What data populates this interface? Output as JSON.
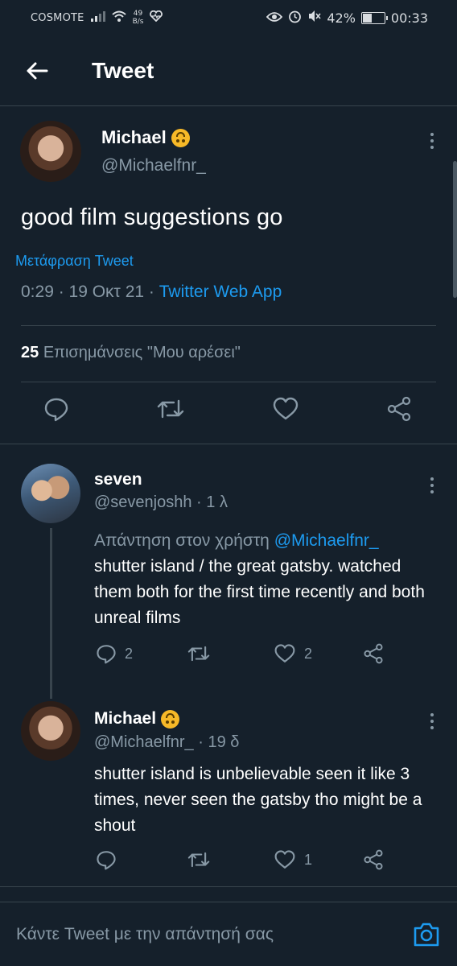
{
  "status_bar": {
    "carrier": "COSMOTE",
    "net_speed_value": "49",
    "net_speed_unit": "B/s",
    "battery": "42%",
    "battery_level": 0.42,
    "time": "00:33"
  },
  "header": {
    "title": "Tweet"
  },
  "main_tweet": {
    "name": "Michael",
    "handle": "@Michaelfnr_",
    "text": "good film suggestions go",
    "translate_label": "Μετάφραση Tweet",
    "timestamp": "0:29 · 19 Οκτ 21 ·",
    "source_app": "Twitter Web App",
    "likes_count": "25",
    "likes_label": "Επισημάνσεις \"Μου αρέσει\""
  },
  "replies": [
    {
      "name": "seven",
      "handle": "@sevenjoshh",
      "time": "· 1 λ",
      "reply_prefix": "Απάντηση στον χρήστη",
      "reply_to": "@Michaelfnr_",
      "text": "shutter island / the great gatsby. watched them both for the first time recently and both unreal films",
      "reply_count": "2",
      "like_count": "2"
    },
    {
      "name": "Michael",
      "handle": "@Michaelfnr_",
      "time": "· 19 δ",
      "text": "shutter island is unbelievable seen it like 3 times, never seen the gatsby tho might be a shout",
      "reply_count": "",
      "like_count": "1"
    }
  ],
  "compose": {
    "placeholder": "Κάντε Tweet με την απάντησή σας"
  },
  "icons": {
    "reply": "speech-bubble-icon",
    "retweet": "retweet-icon",
    "like": "heart-icon",
    "share": "share-icon",
    "camera": "camera-icon"
  },
  "colors": {
    "background": "#15202b",
    "accent": "#1d9bf0",
    "muted": "#8899a6"
  }
}
